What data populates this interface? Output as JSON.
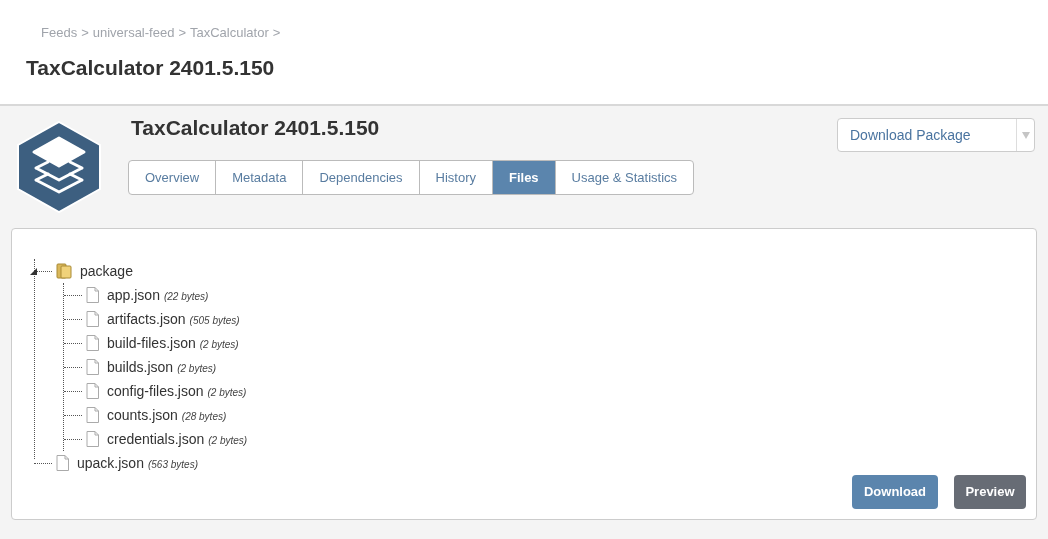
{
  "breadcrumb": [
    {
      "label": "Feeds",
      "separator": ">"
    },
    {
      "label": "universal-feed",
      "separator": ">"
    },
    {
      "label": "TaxCalculator",
      "separator": ">"
    }
  ],
  "page_title": "TaxCalculator 2401.5.150",
  "package_title": "TaxCalculator 2401.5.150",
  "tabs": [
    {
      "label": "Overview",
      "selected": false
    },
    {
      "label": "Metadata",
      "selected": false
    },
    {
      "label": "Dependencies",
      "selected": false
    },
    {
      "label": "History",
      "selected": false
    },
    {
      "label": "Files",
      "selected": true
    },
    {
      "label": "Usage & Statistics",
      "selected": false
    }
  ],
  "download_package": "Download Package",
  "tree": [
    {
      "kind": "folder",
      "name": "package",
      "expanded": true,
      "children": [
        {
          "kind": "file",
          "name": "app.json",
          "size": "(22 bytes)"
        },
        {
          "kind": "file",
          "name": "artifacts.json",
          "size": "(505 bytes)"
        },
        {
          "kind": "file",
          "name": "build-files.json",
          "size": "(2 bytes)"
        },
        {
          "kind": "file",
          "name": "builds.json",
          "size": "(2 bytes)"
        },
        {
          "kind": "file",
          "name": "config-files.json",
          "size": "(2 bytes)"
        },
        {
          "kind": "file",
          "name": "counts.json",
          "size": "(28 bytes)"
        },
        {
          "kind": "file",
          "name": "credentials.json",
          "size": "(2 bytes)"
        }
      ]
    },
    {
      "kind": "file",
      "name": "upack.json",
      "size": "(563 bytes)"
    }
  ],
  "buttons": [
    {
      "label": "Download",
      "kind": "primary"
    },
    {
      "label": "Preview",
      "kind": "secondary"
    }
  ]
}
